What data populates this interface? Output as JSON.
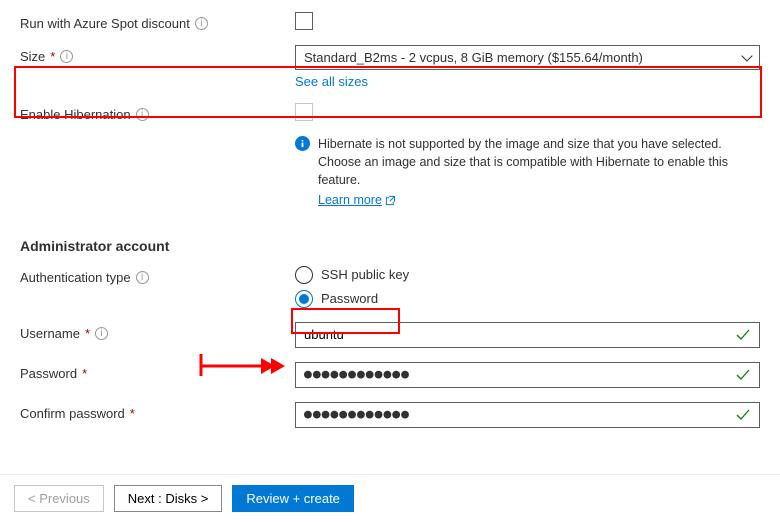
{
  "fields": {
    "spot": {
      "label": "Run with Azure Spot discount"
    },
    "size": {
      "label": "Size",
      "value": "Standard_B2ms - 2 vcpus, 8 GiB memory ($155.64/month)",
      "all_sizes": "See all sizes"
    },
    "hibernation": {
      "label": "Enable Hibernation",
      "note": "Hibernate is not supported by the image and size that you have selected. Choose an image and size that is compatible with Hibernate to enable this feature.",
      "learn_more": "Learn more"
    }
  },
  "admin": {
    "section": "Administrator account",
    "auth_type": {
      "label": "Authentication type",
      "ssh": "SSH public key",
      "password": "Password"
    },
    "username": {
      "label": "Username",
      "value": "ubuntu"
    },
    "password": {
      "label": "Password",
      "value": "●●●●●●●●●●●●"
    },
    "confirm": {
      "label": "Confirm password",
      "value": "●●●●●●●●●●●●"
    }
  },
  "footer": {
    "prev": "<  Previous",
    "next": "Next : Disks  >",
    "review": "Review + create"
  }
}
